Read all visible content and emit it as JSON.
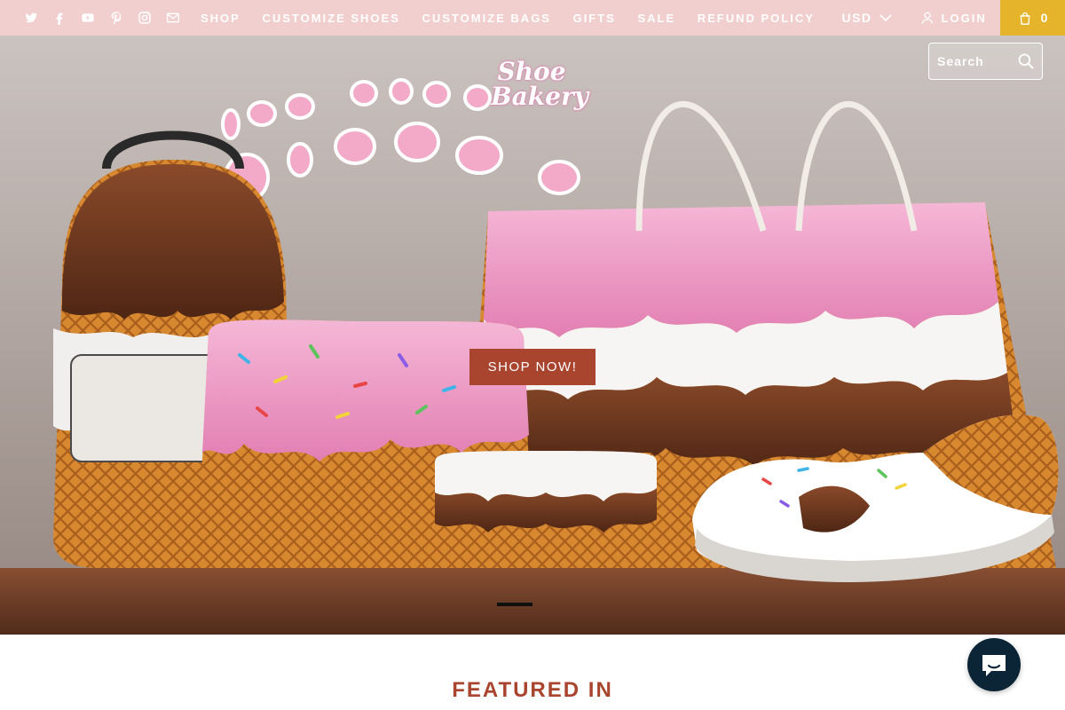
{
  "social": [
    {
      "icon": "twitter-icon"
    },
    {
      "icon": "facebook-icon"
    },
    {
      "icon": "youtube-icon"
    },
    {
      "icon": "pinterest-icon"
    },
    {
      "icon": "instagram-icon"
    },
    {
      "icon": "mail-icon"
    }
  ],
  "nav": {
    "shop": "SHOP",
    "customize_shoes": "CUSTOMIZE SHOES",
    "customize_bags": "CUSTOMIZE BAGS",
    "gifts": "GIFTS",
    "sale": "SALE",
    "refund_policy": "REFUND POLICY"
  },
  "currency": {
    "selected": "USD"
  },
  "account": {
    "login_label": "LOGIN"
  },
  "cart": {
    "count": "0"
  },
  "logo": {
    "line1": "Shoe",
    "line2": "Bakery"
  },
  "search": {
    "placeholder": "Search"
  },
  "hero": {
    "cta_label": "SHOP NOW!",
    "slide_count": 1,
    "active_slide": 1
  },
  "sections": {
    "featured_title": "FEATURED IN"
  },
  "colors": {
    "topbar": "#f2cfcf",
    "cart_bg": "#e6b42b",
    "accent": "#a9442e",
    "chat_bg": "#0b2536"
  }
}
